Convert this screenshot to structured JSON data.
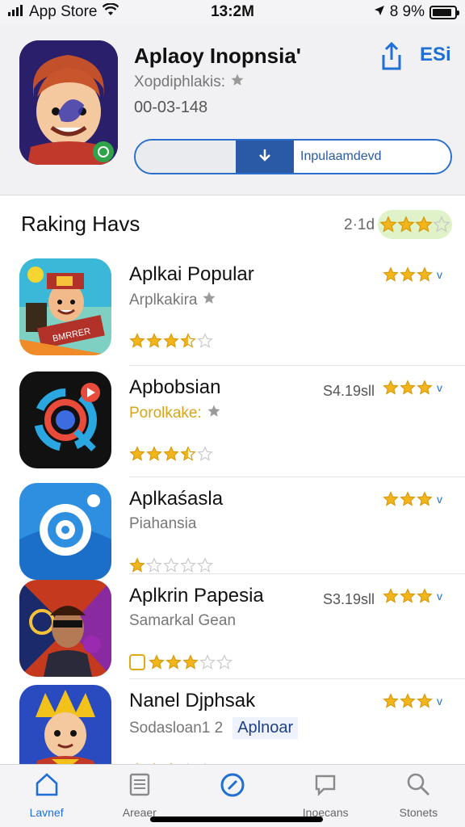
{
  "status_bar": {
    "carrier": "App Store",
    "time": "13:2M",
    "battery_text": "8 9%",
    "battery_level": 0.89
  },
  "header": {
    "app_title": "Aplaoy Inopnsia'",
    "app_subtitle": "Xopdiphlakis:",
    "app_version": "00-03-148",
    "edit_label": "ESi",
    "segment_label": "Inpulaamdevd",
    "icons": {
      "share": "share-icon",
      "download": "download-icon",
      "star": "star-icon"
    }
  },
  "section": {
    "title": "Raking Havs",
    "count": "2·1d",
    "rating": 3
  },
  "apps": [
    {
      "title": "Aplkai Popular",
      "subtitle": "Arplkakira",
      "price": "",
      "row_rating": 3,
      "stars": 3.5,
      "subtitle_star": true,
      "highlight": "",
      "badge": ""
    },
    {
      "title": "Apbobsian",
      "subtitle": "Porolkake:",
      "price": "S4.19sll",
      "row_rating": 3,
      "stars": 3.5,
      "subtitle_star": true,
      "highlight": "yellow",
      "badge": ""
    },
    {
      "title": "Aplkaśasla",
      "subtitle": "Piahansia",
      "price": "",
      "row_rating": 3,
      "stars": 1,
      "subtitle_star": false,
      "highlight": "",
      "badge": ""
    },
    {
      "title": "Aplkrin Papesia",
      "subtitle": "Samarkal Gean",
      "price": "S3.19sll",
      "row_rating": 3,
      "stars": 3,
      "subtitle_star": false,
      "highlight": "",
      "badge": ""
    },
    {
      "title": "Nanel Djphsak",
      "subtitle": "Sodasloan1 2",
      "price": "",
      "row_rating": 3,
      "stars": 3,
      "subtitle_star": false,
      "highlight": "",
      "badge": "Aplnoar"
    }
  ],
  "tabs": [
    {
      "label": "Lavnef",
      "icon": "home-icon",
      "active": true
    },
    {
      "label": "Areaer",
      "icon": "news-icon",
      "active": false
    },
    {
      "label": "",
      "icon": "compass-icon",
      "active": true
    },
    {
      "label": "Inoecans",
      "icon": "chat-icon",
      "active": false
    },
    {
      "label": "Stonets",
      "icon": "search-icon",
      "active": false
    }
  ],
  "colors": {
    "accent": "#1f6fd6",
    "star": "#f2b51b",
    "star_empty": "#c9c9c9"
  }
}
